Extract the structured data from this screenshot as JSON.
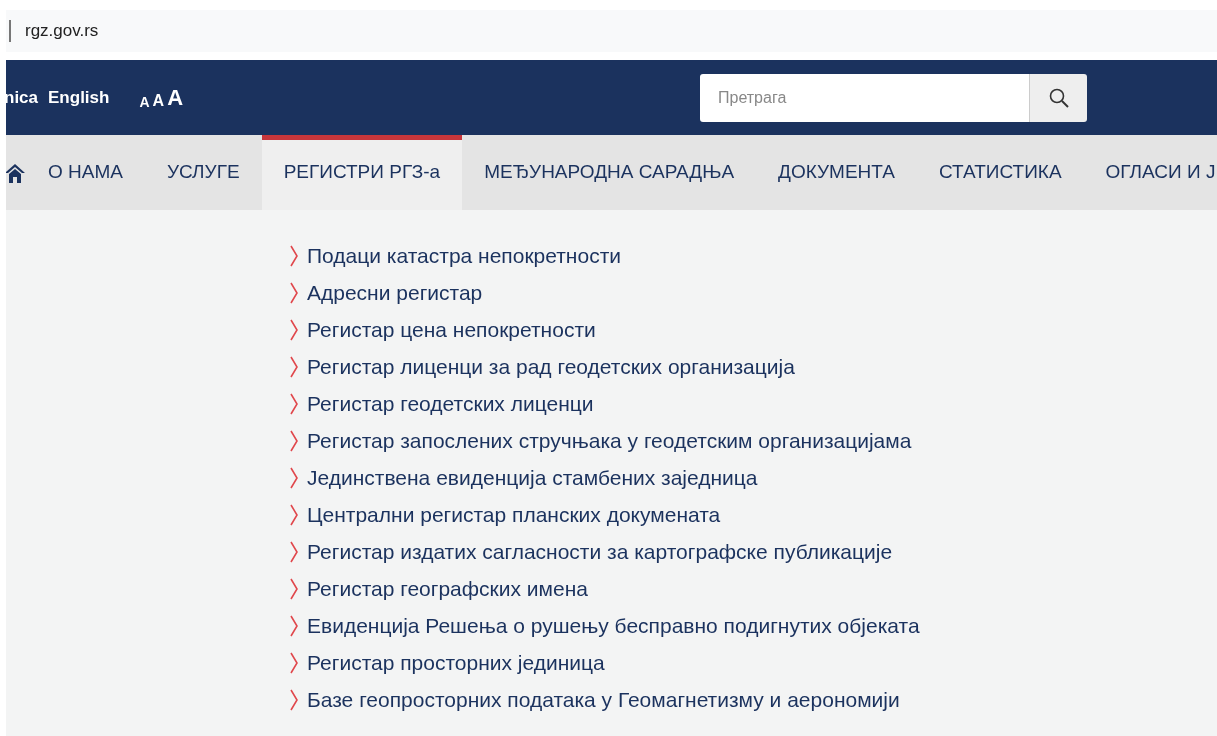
{
  "address_bar": {
    "url": "rgz.gov.rs"
  },
  "header": {
    "languages": [
      "nica",
      "English"
    ],
    "text_sizes": [
      "A",
      "A",
      "A"
    ],
    "search": {
      "placeholder": "Претрага"
    }
  },
  "nav": [
    {
      "label": "О НАМА",
      "selected": false
    },
    {
      "label": "УСЛУГЕ",
      "selected": false
    },
    {
      "label": "РЕГИСТРИ РГЗ-а",
      "selected": true
    },
    {
      "label": "МЕЂУНАРОДНА САРАДЊА",
      "selected": false
    },
    {
      "label": "ДОКУМЕНТА",
      "selected": false
    },
    {
      "label": "СТАТИСТИКА",
      "selected": false
    },
    {
      "label": "ОГЛАСИ И Ј",
      "selected": false
    }
  ],
  "menu": [
    "Подаци катастра непокретности",
    "Адресни регистар",
    "Регистар цена непокретности",
    "Регистар лиценци за рад геодетских организација",
    "Регистар геодетских лиценци",
    "Регистар запослених стручњака у геодетским организацијама",
    "Јединствена евиденција стамбених заједница",
    "Централни регистар планских докумената",
    "Регистар издатих сагласности за картографске публикације",
    "Регистар географских имена",
    "Евиденција Решења о рушењу бесправно подигнутих објеката",
    "Регистар просторних јединица",
    "Базе геопросторних података у Геомагнетизму и аерономији"
  ]
}
